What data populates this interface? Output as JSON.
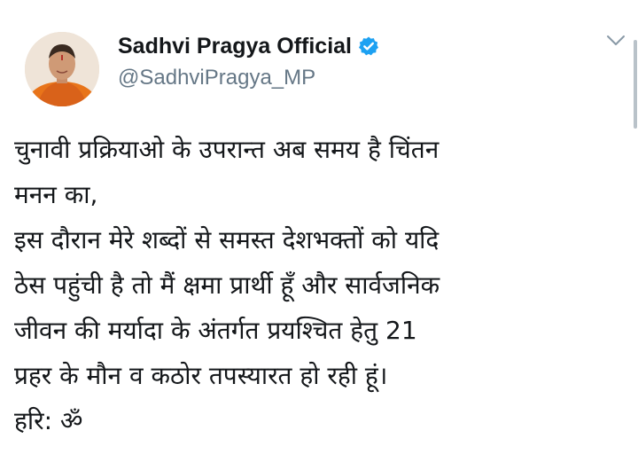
{
  "tweet": {
    "display_name": "Sadhvi Pragya Official",
    "handle": "@SadhviPragya_MP",
    "verified": true,
    "icons": {
      "verified": "verified-badge-icon",
      "menu": "chevron-down-icon"
    },
    "colors": {
      "verified": "#1da1f2",
      "handle": "#657786",
      "text": "#14171a",
      "robe": "#e8741a"
    },
    "lines": [
      "चुनावी प्रक्रियाओ के उपरान्त अब समय है चिंतन",
      "मनन का,",
      "इस दौरान मेरे शब्दों से समस्त देशभक्तों को यदि",
      "ठेस पहुंची है तो मैं क्षमा प्रार्थी हूँ और सार्वजनिक",
      "जीवन की मर्यादा के अंतर्गत प्रयश्चित हेतु 21",
      "प्रहर के मौन व कठोर तपस्यारत हो रही हूं।",
      "हरि: ॐ"
    ]
  }
}
